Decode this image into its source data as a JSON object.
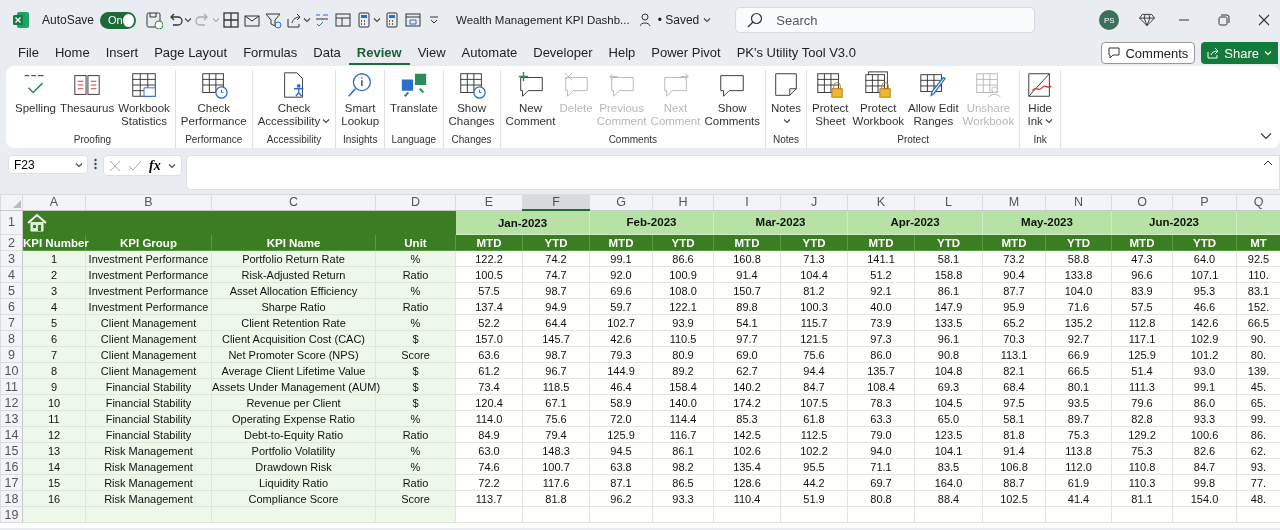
{
  "title_bar": {
    "autosave_label": "AutoSave",
    "autosave": {
      "label": "On",
      "on": true
    },
    "document_title": "Wealth Management KPI Dashb...",
    "save_status": "• Saved",
    "search": {
      "placeholder": "Search"
    },
    "avatar_initials": "PS"
  },
  "menu_tabs": [
    {
      "label": "File",
      "selected": false
    },
    {
      "label": "Home",
      "selected": false
    },
    {
      "label": "Insert",
      "selected": false
    },
    {
      "label": "Page Layout",
      "selected": false
    },
    {
      "label": "Formulas",
      "selected": false
    },
    {
      "label": "Data",
      "selected": false
    },
    {
      "label": "Review",
      "selected": true
    },
    {
      "label": "View",
      "selected": false
    },
    {
      "label": "Automate",
      "selected": false
    },
    {
      "label": "Developer",
      "selected": false
    },
    {
      "label": "Help",
      "selected": false
    },
    {
      "label": "Power Pivot",
      "selected": false
    },
    {
      "label": "PK's Utility Tool V3.0",
      "selected": false
    }
  ],
  "comments_button": "Comments",
  "share_button": "Share",
  "ribbon": {
    "groups": [
      {
        "label": "Proofing",
        "commands": [
          {
            "lines": [
              "Spelling"
            ],
            "disabled": false,
            "dropdown": false
          },
          {
            "lines": [
              "Thesaurus"
            ],
            "disabled": false,
            "dropdown": false
          },
          {
            "lines": [
              "Workbook",
              "Statistics"
            ],
            "disabled": false,
            "dropdown": false
          }
        ]
      },
      {
        "label": "Performance",
        "commands": [
          {
            "lines": [
              "Check",
              "Performance"
            ],
            "disabled": false,
            "dropdown": false
          }
        ]
      },
      {
        "label": "Accessibility",
        "commands": [
          {
            "lines": [
              "Check",
              "Accessibility"
            ],
            "disabled": false,
            "dropdown": true
          }
        ]
      },
      {
        "label": "Insights",
        "commands": [
          {
            "lines": [
              "Smart",
              "Lookup"
            ],
            "disabled": false,
            "dropdown": false
          }
        ]
      },
      {
        "label": "Language",
        "commands": [
          {
            "lines": [
              "Translate"
            ],
            "disabled": false,
            "dropdown": false
          }
        ]
      },
      {
        "label": "Changes",
        "commands": [
          {
            "lines": [
              "Show",
              "Changes"
            ],
            "disabled": false,
            "dropdown": false
          }
        ]
      },
      {
        "label": "Comments",
        "commands": [
          {
            "lines": [
              "New",
              "Comment"
            ],
            "disabled": false,
            "dropdown": false
          },
          {
            "lines": [
              "Delete"
            ],
            "disabled": true,
            "dropdown": false
          },
          {
            "lines": [
              "Previous",
              "Comment"
            ],
            "disabled": true,
            "dropdown": false
          },
          {
            "lines": [
              "Next",
              "Comment"
            ],
            "disabled": true,
            "dropdown": false
          },
          {
            "lines": [
              "Show",
              "Comments"
            ],
            "disabled": false,
            "dropdown": false
          }
        ]
      },
      {
        "label": "Notes",
        "commands": [
          {
            "lines": [
              "Notes"
            ],
            "disabled": false,
            "dropdown": true
          }
        ]
      },
      {
        "label": "Protect",
        "commands": [
          {
            "lines": [
              "Protect",
              "Sheet"
            ],
            "disabled": false,
            "dropdown": false
          },
          {
            "lines": [
              "Protect",
              "Workbook"
            ],
            "disabled": false,
            "dropdown": false
          },
          {
            "lines": [
              "Allow Edit",
              "Ranges"
            ],
            "disabled": false,
            "dropdown": false
          },
          {
            "lines": [
              "Unshare",
              "Workbook"
            ],
            "disabled": true,
            "dropdown": false
          }
        ]
      },
      {
        "label": "Ink",
        "commands": [
          {
            "lines": [
              "Hide",
              "Ink"
            ],
            "disabled": false,
            "dropdown": true
          }
        ]
      }
    ]
  },
  "formula_bar": {
    "name_box": "F23",
    "function_label": "fx"
  },
  "sheet": {
    "columns": [
      {
        "letter": "A",
        "selected": false
      },
      {
        "letter": "B",
        "selected": false
      },
      {
        "letter": "C",
        "selected": false
      },
      {
        "letter": "D",
        "selected": false
      },
      {
        "letter": "E",
        "selected": false
      },
      {
        "letter": "F",
        "selected": true
      },
      {
        "letter": "G",
        "selected": false
      },
      {
        "letter": "H",
        "selected": false
      },
      {
        "letter": "I",
        "selected": false
      },
      {
        "letter": "J",
        "selected": false
      },
      {
        "letter": "K",
        "selected": false
      },
      {
        "letter": "L",
        "selected": false
      },
      {
        "letter": "M",
        "selected": false
      },
      {
        "letter": "N",
        "selected": false
      },
      {
        "letter": "O",
        "selected": false
      },
      {
        "letter": "P",
        "selected": false
      },
      {
        "letter": "Q",
        "selected": false
      }
    ],
    "row_numbers": [
      "1",
      "2",
      "3",
      "4",
      "5",
      "6",
      "7",
      "8",
      "9",
      "10",
      "11",
      "12",
      "13",
      "14",
      "15",
      "16",
      "17",
      "18",
      "19"
    ],
    "months": [
      "Jan-2023",
      "Feb-2023",
      "Mar-2023",
      "Apr-2023",
      "May-2023",
      "Jun-2023"
    ],
    "headers": [
      "KPI Number",
      "KPI Group",
      "KPI Name",
      "Unit",
      "MTD",
      "YTD",
      "MTD",
      "YTD",
      "MTD",
      "YTD",
      "MTD",
      "YTD",
      "MTD",
      "YTD",
      "MTD",
      "YTD",
      "MT"
    ],
    "rows": [
      [
        "1",
        "Investment Performance",
        "Portfolio Return Rate",
        "%",
        "122.2",
        "74.2",
        "99.1",
        "86.6",
        "160.8",
        "71.3",
        "141.1",
        "58.1",
        "73.2",
        "58.8",
        "47.3",
        "64.0",
        "92.5"
      ],
      [
        "2",
        "Investment Performance",
        "Risk-Adjusted Return",
        "Ratio",
        "100.5",
        "74.7",
        "92.0",
        "100.9",
        "91.4",
        "104.4",
        "51.2",
        "158.8",
        "90.4",
        "133.8",
        "96.6",
        "107.1",
        "110."
      ],
      [
        "3",
        "Investment Performance",
        "Asset Allocation Efficiency",
        "%",
        "57.5",
        "98.7",
        "69.6",
        "108.0",
        "150.7",
        "81.2",
        "92.1",
        "86.1",
        "87.7",
        "104.0",
        "83.9",
        "95.3",
        "83.1"
      ],
      [
        "4",
        "Investment Performance",
        "Sharpe Ratio",
        "Ratio",
        "137.4",
        "94.9",
        "59.7",
        "122.1",
        "89.8",
        "100.3",
        "40.0",
        "147.9",
        "95.9",
        "71.6",
        "57.5",
        "46.6",
        "152."
      ],
      [
        "5",
        "Client Management",
        "Client Retention Rate",
        "%",
        "52.2",
        "64.4",
        "102.7",
        "93.9",
        "54.1",
        "115.7",
        "73.9",
        "133.5",
        "65.2",
        "135.2",
        "112.8",
        "142.6",
        "66.5"
      ],
      [
        "6",
        "Client Management",
        "Client Acquisition Cost (CAC)",
        "$",
        "157.0",
        "145.7",
        "42.6",
        "110.5",
        "97.7",
        "121.5",
        "97.3",
        "96.1",
        "70.3",
        "92.7",
        "117.1",
        "102.9",
        "90."
      ],
      [
        "7",
        "Client Management",
        "Net Promoter Score (NPS)",
        "Score",
        "63.6",
        "98.7",
        "79.3",
        "80.9",
        "69.0",
        "75.6",
        "86.0",
        "90.8",
        "113.1",
        "66.9",
        "125.9",
        "101.2",
        "80."
      ],
      [
        "8",
        "Client Management",
        "Average Client Lifetime Value",
        "$",
        "61.2",
        "96.7",
        "144.9",
        "89.2",
        "62.7",
        "94.4",
        "135.7",
        "104.8",
        "82.1",
        "66.5",
        "51.4",
        "93.0",
        "139."
      ],
      [
        "9",
        "Financial Stability",
        "Assets Under Management (AUM)",
        "$",
        "73.4",
        "118.5",
        "46.4",
        "158.4",
        "140.2",
        "84.7",
        "108.4",
        "69.3",
        "68.4",
        "80.1",
        "111.3",
        "99.1",
        "45."
      ],
      [
        "10",
        "Financial Stability",
        "Revenue per Client",
        "$",
        "120.4",
        "67.1",
        "58.9",
        "140.0",
        "174.2",
        "107.5",
        "78.3",
        "104.5",
        "97.5",
        "93.5",
        "79.6",
        "86.0",
        "65."
      ],
      [
        "11",
        "Financial Stability",
        "Operating Expense Ratio",
        "%",
        "114.0",
        "75.6",
        "72.0",
        "114.4",
        "85.3",
        "61.8",
        "63.3",
        "65.0",
        "58.1",
        "89.7",
        "82.8",
        "93.3",
        "99."
      ],
      [
        "12",
        "Financial Stability",
        "Debt-to-Equity Ratio",
        "Ratio",
        "84.9",
        "79.4",
        "125.9",
        "116.7",
        "142.5",
        "112.5",
        "79.0",
        "123.5",
        "81.8",
        "75.3",
        "129.2",
        "100.6",
        "86."
      ],
      [
        "13",
        "Risk Management",
        "Portfolio Volatility",
        "%",
        "63.0",
        "148.3",
        "94.5",
        "86.1",
        "102.6",
        "102.2",
        "94.0",
        "104.1",
        "91.4",
        "113.8",
        "75.3",
        "82.6",
        "62."
      ],
      [
        "14",
        "Risk Management",
        "Drawdown Risk",
        "%",
        "74.6",
        "100.7",
        "63.8",
        "98.2",
        "135.4",
        "95.5",
        "71.1",
        "83.5",
        "106.8",
        "112.0",
        "110.8",
        "84.7",
        "93."
      ],
      [
        "15",
        "Risk Management",
        "Liquidity Ratio",
        "Ratio",
        "72.2",
        "117.6",
        "87.1",
        "86.5",
        "128.6",
        "44.2",
        "69.7",
        "164.0",
        "88.7",
        "61.9",
        "110.3",
        "99.8",
        "77."
      ],
      [
        "16",
        "Risk Management",
        "Compliance Score",
        "Score",
        "113.7",
        "81.8",
        "96.2",
        "93.3",
        "110.4",
        "51.9",
        "80.8",
        "88.4",
        "102.5",
        "41.4",
        "81.1",
        "154.0",
        "48."
      ]
    ]
  }
}
